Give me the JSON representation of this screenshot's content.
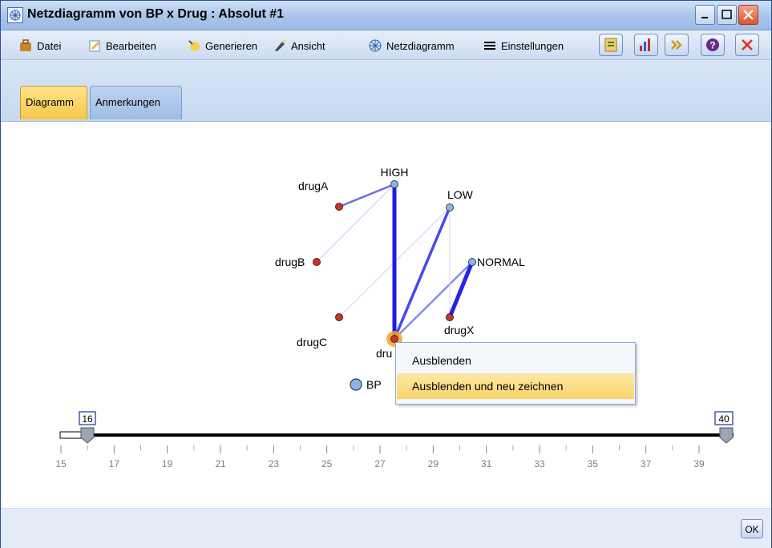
{
  "window": {
    "title": "Netzdiagramm von BP x Drug : Absolut #1"
  },
  "menu": [
    {
      "label": "Datei",
      "icon": "briefcase-icon"
    },
    {
      "label": "Bearbeiten",
      "icon": "edit-icon"
    },
    {
      "label": "Generieren",
      "icon": "generate-icon"
    },
    {
      "label": "Ansicht",
      "icon": "view-icon"
    },
    {
      "label": "Netzdiagramm",
      "icon": "web-icon"
    },
    {
      "label": "Einstellungen",
      "icon": "menu-lines-icon"
    }
  ],
  "tabs": [
    {
      "label": "Diagramm",
      "active": true
    },
    {
      "label": "Anmerkungen",
      "active": false
    }
  ],
  "graph": {
    "nodes": [
      {
        "id": "HIGH",
        "label": "HIGH",
        "group": "BP"
      },
      {
        "id": "LOW",
        "label": "LOW",
        "group": "BP"
      },
      {
        "id": "NORMAL",
        "label": "NORMAL",
        "group": "BP"
      },
      {
        "id": "drugA",
        "label": "drugA",
        "group": "Drug"
      },
      {
        "id": "drugB",
        "label": "drugB",
        "group": "Drug"
      },
      {
        "id": "drugC",
        "label": "drugC",
        "group": "Drug"
      },
      {
        "id": "drugX",
        "label": "drugX",
        "group": "Drug"
      },
      {
        "id": "drugY",
        "label": "dru",
        "group": "Drug",
        "selected": true
      }
    ],
    "links": [
      {
        "source": "drugA",
        "target": "HIGH",
        "strength": "medium"
      },
      {
        "source": "drugB",
        "target": "HIGH",
        "strength": "weak"
      },
      {
        "source": "drugC",
        "target": "LOW",
        "strength": "weak"
      },
      {
        "source": "drugY",
        "target": "HIGH",
        "strength": "strong"
      },
      {
        "source": "drugY",
        "target": "LOW",
        "strength": "medium-strong"
      },
      {
        "source": "drugY",
        "target": "NORMAL",
        "strength": "medium"
      },
      {
        "source": "drugX",
        "target": "LOW",
        "strength": "weak"
      },
      {
        "source": "drugX",
        "target": "NORMAL",
        "strength": "strong"
      }
    ],
    "legend": {
      "label": "BP"
    }
  },
  "slider": {
    "min_value": "16",
    "max_value": "40",
    "ticks": [
      "15",
      "17",
      "19",
      "21",
      "23",
      "25",
      "27",
      "29",
      "31",
      "33",
      "35",
      "37",
      "39"
    ]
  },
  "context_menu": {
    "items": [
      {
        "label": "Ausblenden",
        "highlighted": false
      },
      {
        "label": "Ausblenden und neu zeichnen",
        "highlighted": true
      }
    ]
  },
  "footer": {
    "ok_label": "OK"
  },
  "colors": {
    "bp_node": "#8db4e2",
    "drug_node": "#c0392b",
    "link": "#3a3ae8",
    "selected_halo": "#f5a623",
    "context_highlight": "#f9d46b"
  }
}
